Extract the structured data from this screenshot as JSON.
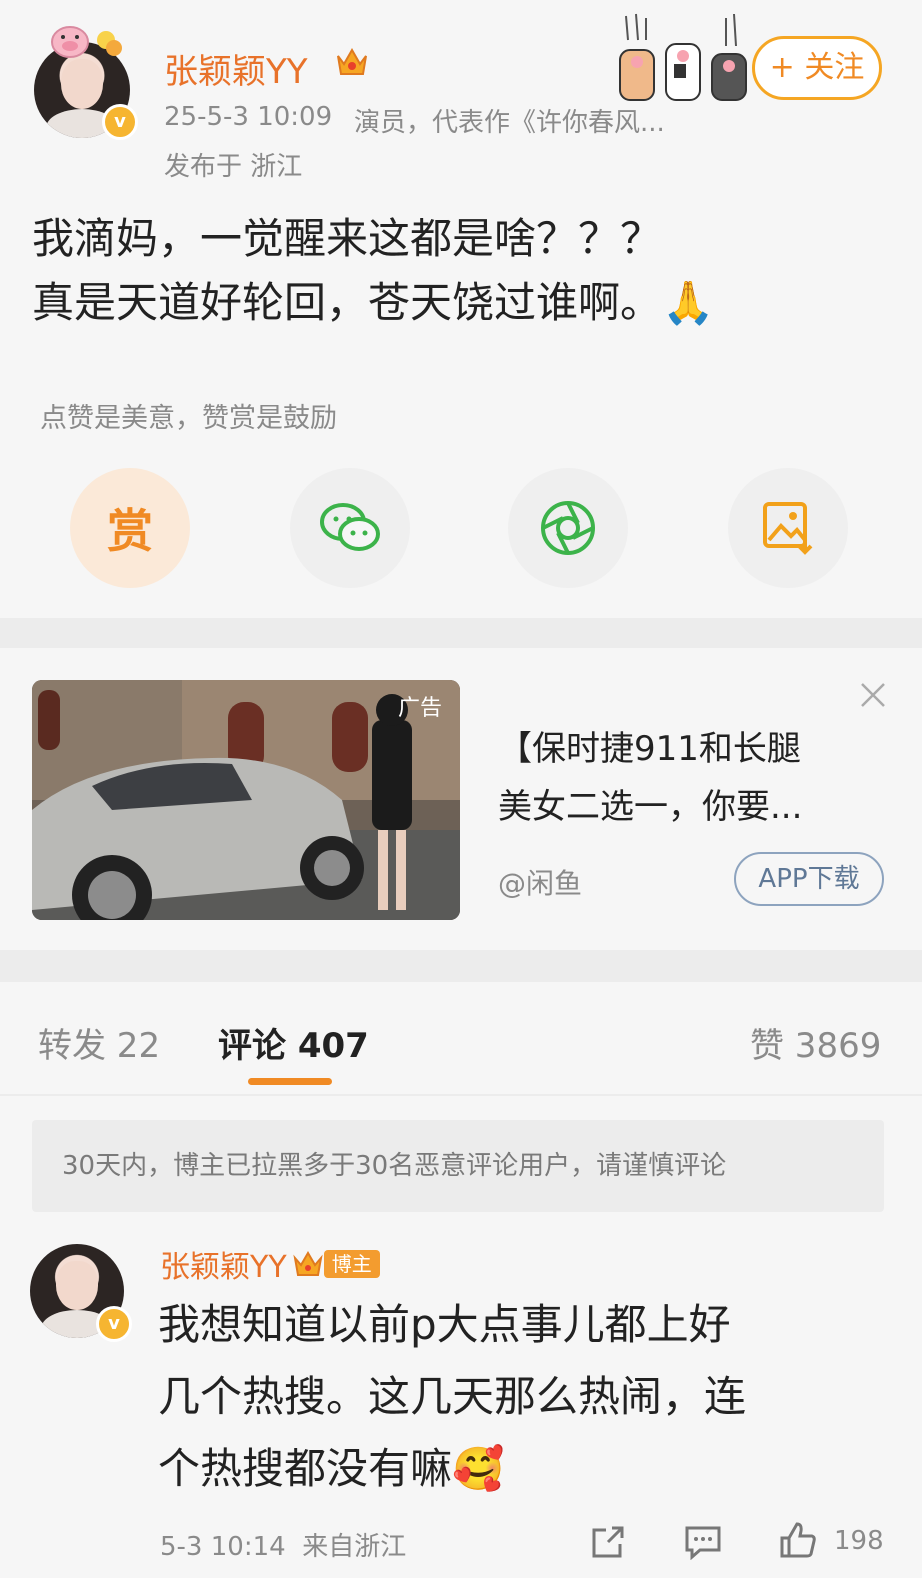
{
  "post": {
    "author_name": "张颖颖YY",
    "time": "25-5-3 10:09",
    "bio": "演员，代表作《许你春风...",
    "location": "发布于 浙江",
    "follow_label": "+ 关注",
    "text_line1": "我滴妈，一觉醒来这都是啥？？？",
    "text_line2": "真是天道好轮回，苍天饶过谁啊。🙏",
    "reward_hint": "点赞是美意，赞赏是鼓励",
    "reward_label": "赏",
    "icons": [
      "wechat-icon",
      "moments-icon",
      "save-image-icon"
    ],
    "verified_badge": "v"
  },
  "ad": {
    "tag": "广告",
    "title_line1": "【保时捷911和长腿",
    "title_line2": "美女二选一，你要...",
    "source": "@闲鱼",
    "cta": "APP下载"
  },
  "tabs": {
    "repost": "转发 22",
    "comments": "评论 407",
    "likes": "赞 3869"
  },
  "notice": "30天内，博主已拉黑多于30名恶意评论用户，请谨慎评论",
  "comment": {
    "author_name": "张颖颖YY",
    "owner_tag": "博主",
    "text_line1": "我想知道以前p大点事儿都上好",
    "text_line2": "几个热搜。这几天那么热闹，连",
    "text_line3": "个热搜都没有嘛🥰",
    "time_location": "5-3 10:14  来自浙江",
    "like_count": "198"
  },
  "colors": {
    "accent": "#f08a24",
    "background": "#f6f6f6",
    "divider": "#ececec"
  }
}
